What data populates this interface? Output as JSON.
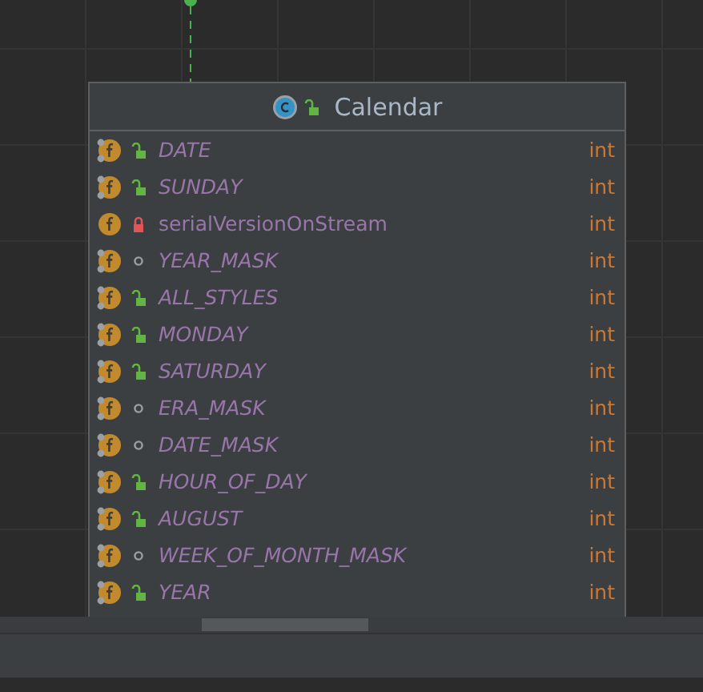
{
  "class_node": {
    "title": "Calendar",
    "kind": "public",
    "fields": [
      {
        "name": "DATE",
        "type": "int",
        "static": true,
        "kind": "public"
      },
      {
        "name": "SUNDAY",
        "type": "int",
        "static": true,
        "kind": "public"
      },
      {
        "name": "serialVersionOnStream",
        "type": "int",
        "static": false,
        "kind": "private"
      },
      {
        "name": "YEAR_MASK",
        "type": "int",
        "static": true,
        "kind": "package"
      },
      {
        "name": "ALL_STYLES",
        "type": "int",
        "static": true,
        "kind": "public"
      },
      {
        "name": "MONDAY",
        "type": "int",
        "static": true,
        "kind": "public"
      },
      {
        "name": "SATURDAY",
        "type": "int",
        "static": true,
        "kind": "public"
      },
      {
        "name": "ERA_MASK",
        "type": "int",
        "static": true,
        "kind": "package"
      },
      {
        "name": "DATE_MASK",
        "type": "int",
        "static": true,
        "kind": "package"
      },
      {
        "name": "HOUR_OF_DAY",
        "type": "int",
        "static": true,
        "kind": "public"
      },
      {
        "name": "AUGUST",
        "type": "int",
        "static": true,
        "kind": "public"
      },
      {
        "name": "WEEK_OF_MONTH_MASK",
        "type": "int",
        "static": true,
        "kind": "package"
      },
      {
        "name": "YEAR",
        "type": "int",
        "static": true,
        "kind": "public"
      }
    ]
  }
}
